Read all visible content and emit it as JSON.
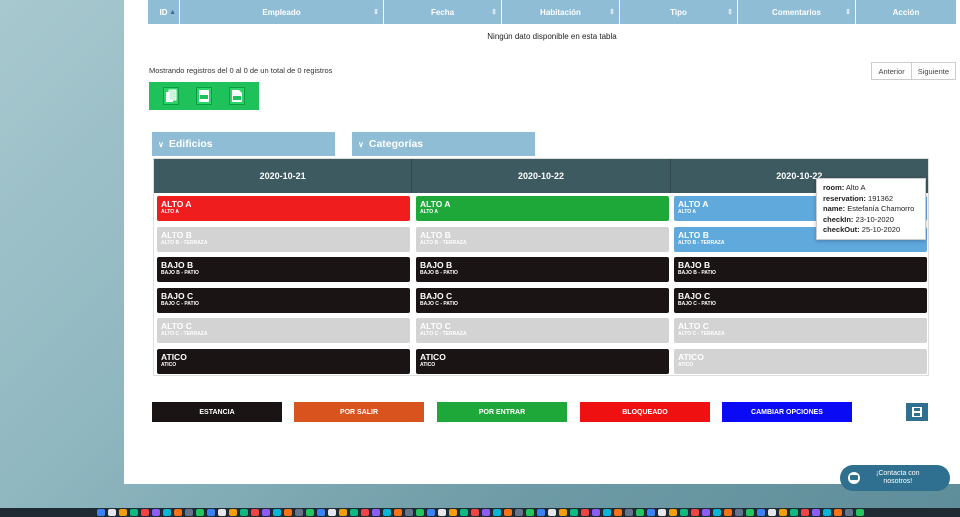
{
  "table": {
    "columns": [
      "ID",
      "Empleado",
      "Fecha",
      "Habitación",
      "Tipo",
      "Comentarios",
      "Acción"
    ],
    "empty_message": "Ningún dato disponible en esta tabla",
    "info": "Mostrando registros del 0 al 0 de un total de 0 registros",
    "prev_label": "Anterior",
    "next_label": "Siguiente"
  },
  "exports": [
    "copy-icon",
    "excel-icon",
    "pdf-icon"
  ],
  "filters": {
    "buildings": "Edificios",
    "categories": "Categorías"
  },
  "calendar": {
    "days": [
      "2020-10-21",
      "2020-10-22",
      "2020-10-22"
    ],
    "rows": [
      [
        {
          "room": "ALTO A",
          "sub": "ALTO A",
          "status": "bloqueado"
        },
        {
          "room": "ALTO A",
          "sub": "ALTO A",
          "status": "porentrar"
        },
        {
          "room": "ALTO A",
          "sub": "ALTO A",
          "status": "reserv"
        }
      ],
      [
        {
          "room": "ALTO B",
          "sub": "ALTO B - TERRAZA",
          "status": "libre"
        },
        {
          "room": "ALTO B",
          "sub": "ALTO B - TERRAZA",
          "status": "libre"
        },
        {
          "room": "ALTO B",
          "sub": "ALTO B - TERRAZA",
          "status": "reserv"
        }
      ],
      [
        {
          "room": "BAJO B",
          "sub": "BAJO B - PATIO",
          "status": "estancia"
        },
        {
          "room": "BAJO B",
          "sub": "BAJO B - PATIO",
          "status": "estancia"
        },
        {
          "room": "BAJO B",
          "sub": "BAJO B - PATIO",
          "status": "estancia"
        }
      ],
      [
        {
          "room": "BAJO C",
          "sub": "BAJO C - PATIO",
          "status": "estancia"
        },
        {
          "room": "BAJO C",
          "sub": "BAJO C - PATIO",
          "status": "estancia"
        },
        {
          "room": "BAJO C",
          "sub": "BAJO C - PATIO",
          "status": "estancia"
        }
      ],
      [
        {
          "room": "ALTO C",
          "sub": "ALTO C - TERRAZA",
          "status": "libre"
        },
        {
          "room": "ALTO C",
          "sub": "ALTO C - TERRAZA",
          "status": "libre"
        },
        {
          "room": "ALTO C",
          "sub": "ALTO C - TERRAZA",
          "status": "libre"
        }
      ],
      [
        {
          "room": "ATICO",
          "sub": "ATICO",
          "status": "estancia"
        },
        {
          "room": "ATICO",
          "sub": "ATICO",
          "status": "estancia"
        },
        {
          "room": "ATICO",
          "sub": "ATICO",
          "status": "libre"
        }
      ]
    ]
  },
  "tooltip": {
    "room_key": "room:",
    "room_val": "Alto A",
    "reservation_key": "reservation:",
    "reservation_val": "191362",
    "name_key": "name:",
    "name_val": "Estefanía Chamorro",
    "checkin_key": "checkIn:",
    "checkin_val": "23-10-2020",
    "checkout_key": "checkOut:",
    "checkout_val": "25-10-2020"
  },
  "legend": [
    {
      "label": "ESTANCIA",
      "color": "#1b1414"
    },
    {
      "label": "POR SALIR",
      "color": "#d9531e"
    },
    {
      "label": "POR ENTRAR",
      "color": "#1fa83a"
    },
    {
      "label": "BLOQUEADO",
      "color": "#ef1111"
    },
    {
      "label": "CAMBIAR OPCIONES",
      "color": "#0a0af5"
    }
  ],
  "contact": {
    "line1": "¡Contacta con",
    "line2": "nosotros!"
  },
  "colors": {
    "header_blue": "#8fbdd5",
    "calendar_header": "#3d5a60",
    "export_green": "#1ec15a",
    "accent": "#2f6f8f"
  }
}
